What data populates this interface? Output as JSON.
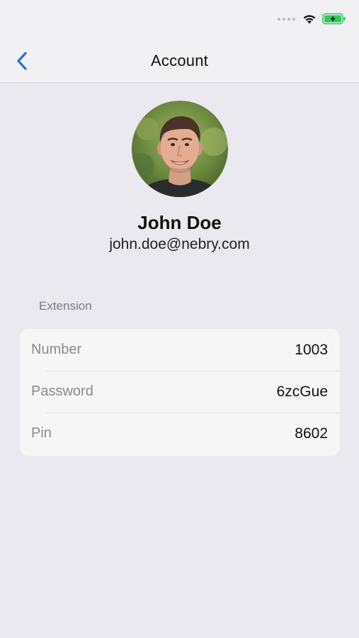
{
  "status_bar": {
    "signal_icon": "signal-dots-icon",
    "wifi_icon": "wifi-icon",
    "battery_icon": "battery-charging-icon"
  },
  "nav": {
    "title": "Account",
    "back_icon": "chevron-left-icon"
  },
  "profile": {
    "name": "John Doe",
    "email": "john.doe@nebry.com"
  },
  "extension": {
    "header": "Extension",
    "rows": [
      {
        "label": "Number",
        "value": "1003"
      },
      {
        "label": "Password",
        "value": "6zcGue"
      },
      {
        "label": "Pin",
        "value": "8602"
      }
    ]
  },
  "colors": {
    "accent": "#2a6fd6",
    "background": "#e9e9ef",
    "battery": "#34c759"
  }
}
